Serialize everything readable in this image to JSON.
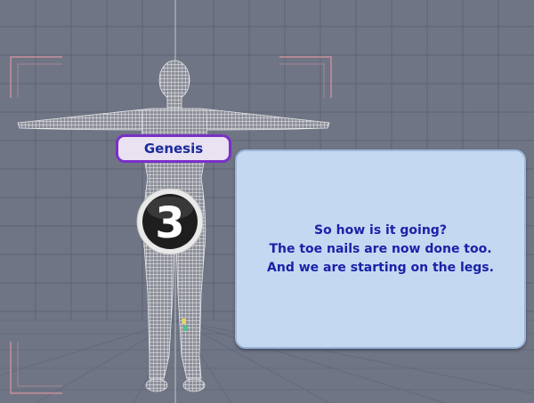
{
  "figure": {
    "name_label": "Genesis",
    "badge_number": "3"
  },
  "message": {
    "lines": [
      "So how is it going?",
      "The toe nails are now done too.",
      "And we are starting on the legs."
    ]
  },
  "colors": {
    "viewport_bg": "#6f7584",
    "grid_line": "#5a6070",
    "mesh": "#e6e6ea",
    "label_border": "#7a2fc8",
    "label_bg": "#e8e2f1",
    "label_text": "#1b2a9c",
    "message_bg": "#c5d8f1",
    "message_text": "#1a22a8",
    "frame_corner": "#c9909c"
  }
}
